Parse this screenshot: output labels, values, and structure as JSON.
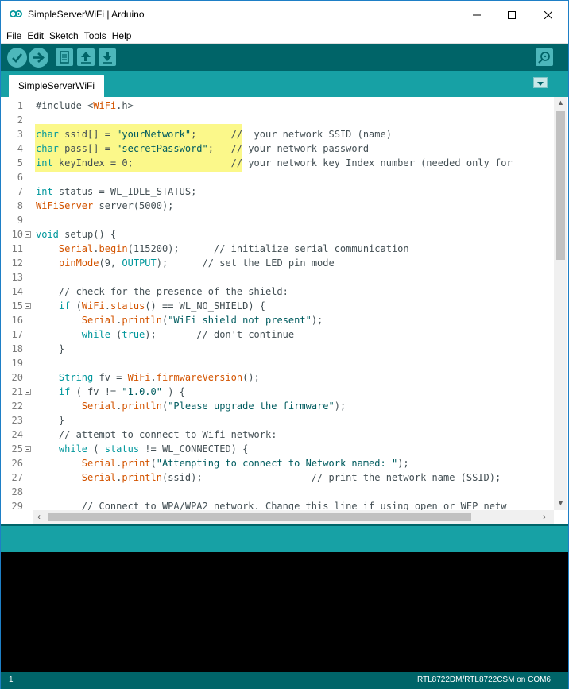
{
  "window": {
    "title": "SimpleServerWiFi | Arduino",
    "minimize_symbol": "─",
    "maximize_symbol": "☐",
    "close_symbol": "✕"
  },
  "menu": [
    "File",
    "Edit",
    "Sketch",
    "Tools",
    "Help"
  ],
  "toolbar": {
    "buttons": [
      "verify-icon",
      "upload-icon",
      "new-icon",
      "open-icon",
      "save-icon",
      "serial-monitor-icon"
    ],
    "accent": "#006468",
    "button_color": "#4db7bb"
  },
  "tabs": {
    "active": "SimpleServerWiFi"
  },
  "editor": {
    "lines": [
      {
        "n": "1",
        "segs": [
          [
            "#include <",
            ""
          ],
          [
            "WiFi",
            "fn"
          ],
          [
            ".h>",
            ""
          ]
        ]
      },
      {
        "n": "2",
        "segs": []
      },
      {
        "n": "3",
        "segs": [
          [
            "char",
            "kw"
          ],
          [
            " ssid[] = ",
            ""
          ],
          [
            "\"yourNetwork\"",
            "str"
          ],
          [
            ";      //  your network SSID (name)",
            ""
          ]
        ]
      },
      {
        "n": "4",
        "segs": [
          [
            "char",
            "kw"
          ],
          [
            " pass[] = ",
            ""
          ],
          [
            "\"secretPassword\"",
            "str"
          ],
          [
            ";   // your network password",
            ""
          ]
        ]
      },
      {
        "n": "5",
        "segs": [
          [
            "int",
            "kw"
          ],
          [
            " keyIndex = 0;                 // your network key Index number (needed only for",
            ""
          ]
        ]
      },
      {
        "n": "6",
        "segs": []
      },
      {
        "n": "7",
        "segs": [
          [
            "int",
            "kw"
          ],
          [
            " status = WL_IDLE_STATUS;",
            ""
          ]
        ]
      },
      {
        "n": "8",
        "segs": [
          [
            "WiFiServer",
            "fn"
          ],
          [
            " server(5000);",
            ""
          ]
        ]
      },
      {
        "n": "9",
        "segs": []
      },
      {
        "n": "10",
        "fold": true,
        "segs": [
          [
            "void",
            "kw"
          ],
          [
            " setup() {",
            ""
          ]
        ]
      },
      {
        "n": "11",
        "segs": [
          [
            "    ",
            ""
          ],
          [
            "Serial",
            "fn"
          ],
          [
            ".",
            ""
          ],
          [
            "begin",
            "fn"
          ],
          [
            "(115200);      // initialize serial communication",
            ""
          ]
        ]
      },
      {
        "n": "12",
        "segs": [
          [
            "    ",
            ""
          ],
          [
            "pinMode",
            "fn"
          ],
          [
            "(9, ",
            ""
          ],
          [
            "OUTPUT",
            "kw"
          ],
          [
            ");      // set the LED pin mode",
            ""
          ]
        ]
      },
      {
        "n": "13",
        "segs": []
      },
      {
        "n": "14",
        "segs": [
          [
            "    // check for the presence of the shield:",
            ""
          ]
        ]
      },
      {
        "n": "15",
        "fold": true,
        "segs": [
          [
            "    ",
            ""
          ],
          [
            "if",
            "kw"
          ],
          [
            " (",
            ""
          ],
          [
            "WiFi",
            "fn"
          ],
          [
            ".",
            ""
          ],
          [
            "status",
            "fn"
          ],
          [
            "() == WL_NO_SHIELD) {",
            ""
          ]
        ]
      },
      {
        "n": "16",
        "segs": [
          [
            "        ",
            ""
          ],
          [
            "Serial",
            "fn"
          ],
          [
            ".",
            ""
          ],
          [
            "println",
            "fn"
          ],
          [
            "(",
            ""
          ],
          [
            "\"WiFi shield not present\"",
            "str"
          ],
          [
            ");",
            ""
          ]
        ]
      },
      {
        "n": "17",
        "segs": [
          [
            "        ",
            ""
          ],
          [
            "while",
            "kw"
          ],
          [
            " (",
            ""
          ],
          [
            "true",
            "kw"
          ],
          [
            ");       // don't continue",
            ""
          ]
        ]
      },
      {
        "n": "18",
        "segs": [
          [
            "    }",
            ""
          ]
        ]
      },
      {
        "n": "19",
        "segs": []
      },
      {
        "n": "20",
        "segs": [
          [
            "    ",
            ""
          ],
          [
            "String",
            "kw"
          ],
          [
            " fv = ",
            ""
          ],
          [
            "WiFi",
            "fn"
          ],
          [
            ".",
            ""
          ],
          [
            "firmwareVersion",
            "fn"
          ],
          [
            "();",
            ""
          ]
        ]
      },
      {
        "n": "21",
        "fold": true,
        "segs": [
          [
            "    ",
            ""
          ],
          [
            "if",
            "kw"
          ],
          [
            " ( fv != ",
            ""
          ],
          [
            "\"1.0.0\"",
            "str"
          ],
          [
            " ) {",
            ""
          ]
        ]
      },
      {
        "n": "22",
        "segs": [
          [
            "        ",
            ""
          ],
          [
            "Serial",
            "fn"
          ],
          [
            ".",
            ""
          ],
          [
            "println",
            "fn"
          ],
          [
            "(",
            ""
          ],
          [
            "\"Please upgrade the firmware\"",
            "str"
          ],
          [
            ");",
            ""
          ]
        ]
      },
      {
        "n": "23",
        "segs": [
          [
            "    }",
            ""
          ]
        ]
      },
      {
        "n": "24",
        "segs": [
          [
            "    // attempt to connect to Wifi network:",
            ""
          ]
        ]
      },
      {
        "n": "25",
        "fold": true,
        "segs": [
          [
            "    ",
            ""
          ],
          [
            "while",
            "kw"
          ],
          [
            " ( ",
            ""
          ],
          [
            "status",
            "kw"
          ],
          [
            " != WL_CONNECTED) {",
            ""
          ]
        ]
      },
      {
        "n": "26",
        "segs": [
          [
            "        ",
            ""
          ],
          [
            "Serial",
            "fn"
          ],
          [
            ".",
            ""
          ],
          [
            "print",
            "fn"
          ],
          [
            "(",
            ""
          ],
          [
            "\"Attempting to connect to Network named: \"",
            "str"
          ],
          [
            ");",
            ""
          ]
        ]
      },
      {
        "n": "27",
        "segs": [
          [
            "        ",
            ""
          ],
          [
            "Serial",
            "fn"
          ],
          [
            ".",
            ""
          ],
          [
            "println",
            "fn"
          ],
          [
            "(ssid);                   // print the network name (SSID);",
            ""
          ]
        ]
      },
      {
        "n": "28",
        "segs": []
      },
      {
        "n": "29",
        "segs": [
          [
            "        // Connect to WPA/WPA2 network. Change this line if using open or WEP netw",
            ""
          ]
        ]
      }
    ]
  },
  "footer": {
    "line": "1",
    "board": "RTL8722DM/RTL8722CSM on COM6"
  },
  "colors": {
    "keyword": "#00979c",
    "function": "#d35400",
    "string": "#005c5f",
    "highlight": "#fbf88a",
    "tab_band": "#17a1a5"
  }
}
